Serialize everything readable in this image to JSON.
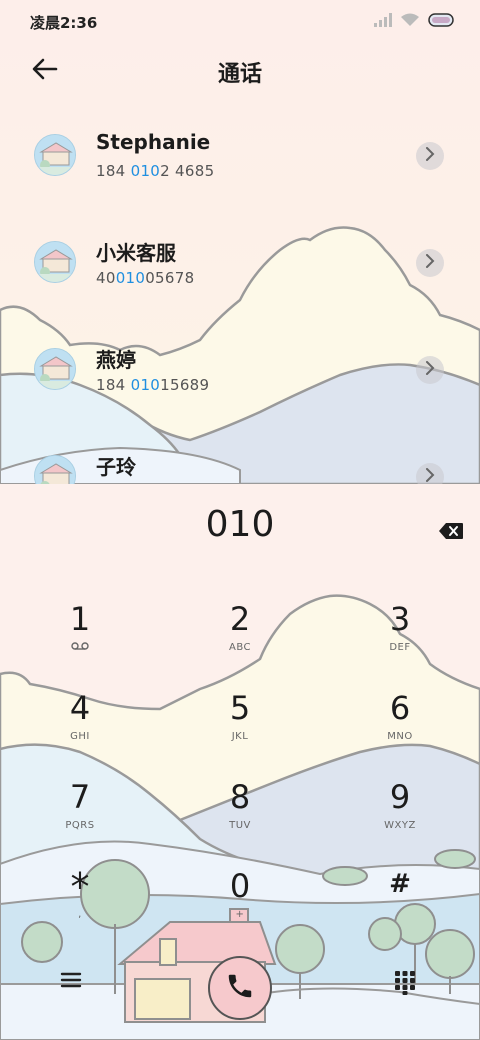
{
  "status_bar": {
    "time": "凌晨2:36"
  },
  "header": {
    "title": "通话"
  },
  "contacts": [
    {
      "name": "Stephanie",
      "phone_pre": "184 ",
      "phone_hl": "010",
      "phone_post": "2 4685"
    },
    {
      "name": "小米客服",
      "phone_pre": "40",
      "phone_hl": "010",
      "phone_post": "05678"
    },
    {
      "name": "燕婷",
      "phone_pre": "184 ",
      "phone_hl": "010",
      "phone_post": "15689"
    },
    {
      "name": "子玲",
      "phone_pre": "",
      "phone_hl": "",
      "phone_post": ""
    }
  ],
  "dialer": {
    "input": "010",
    "keys": [
      {
        "digit": "1",
        "letters": ""
      },
      {
        "digit": "2",
        "letters": "ABC"
      },
      {
        "digit": "3",
        "letters": "DEF"
      },
      {
        "digit": "4",
        "letters": "GHI"
      },
      {
        "digit": "5",
        "letters": "JKL"
      },
      {
        "digit": "6",
        "letters": "MNO"
      },
      {
        "digit": "7",
        "letters": "PQRS"
      },
      {
        "digit": "8",
        "letters": "TUV"
      },
      {
        "digit": "9",
        "letters": "WXYZ"
      },
      {
        "digit": "*",
        "letters": ","
      },
      {
        "digit": "0",
        "letters": "+"
      },
      {
        "digit": "#",
        "letters": ""
      }
    ]
  },
  "colors": {
    "highlight": "#1f8fe0",
    "call_button": "#f6c9cc",
    "background": "#fdf0ec"
  },
  "icons": {
    "back": "back-arrow-icon",
    "chevron": "chevron-right-icon",
    "backspace": "backspace-icon",
    "call": "phone-icon",
    "menu": "menu-icon",
    "keypad": "keypad-icon",
    "voicemail": "voicemail-icon"
  }
}
